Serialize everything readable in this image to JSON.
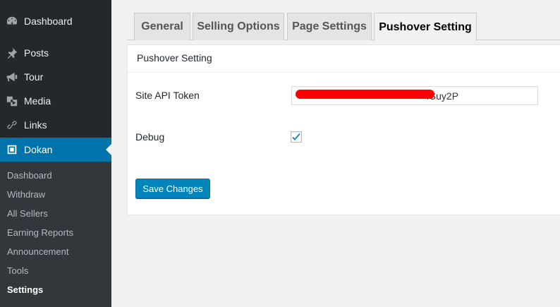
{
  "sidebar": {
    "items": [
      {
        "label": "Dashboard",
        "icon": "dashboard-icon"
      },
      {
        "label": "Posts",
        "icon": "pin-icon"
      },
      {
        "label": "Tour",
        "icon": "megaphone-icon"
      },
      {
        "label": "Media",
        "icon": "media-icon"
      },
      {
        "label": "Links",
        "icon": "link-icon"
      },
      {
        "label": "Dokan",
        "icon": "dokan-icon",
        "active": true
      }
    ],
    "submenu": [
      "Dashboard",
      "Withdraw",
      "All Sellers",
      "Earning Reports",
      "Announcement",
      "Tools",
      "Settings"
    ],
    "submenu_current": "Settings"
  },
  "tabs": [
    "General",
    "Selling Options",
    "Page Settings",
    "Pushover Setting"
  ],
  "active_tab": "Pushover Setting",
  "panel": {
    "title": "Pushover Setting",
    "api_token_label": "Site API Token",
    "api_token_value_visible": "4Suy2P",
    "debug_label": "Debug",
    "debug_checked": true,
    "save_label": "Save Changes"
  },
  "colors": {
    "sidebar_bg": "#23282d",
    "active_menu": "#0073aa",
    "button": "#0085ba"
  }
}
